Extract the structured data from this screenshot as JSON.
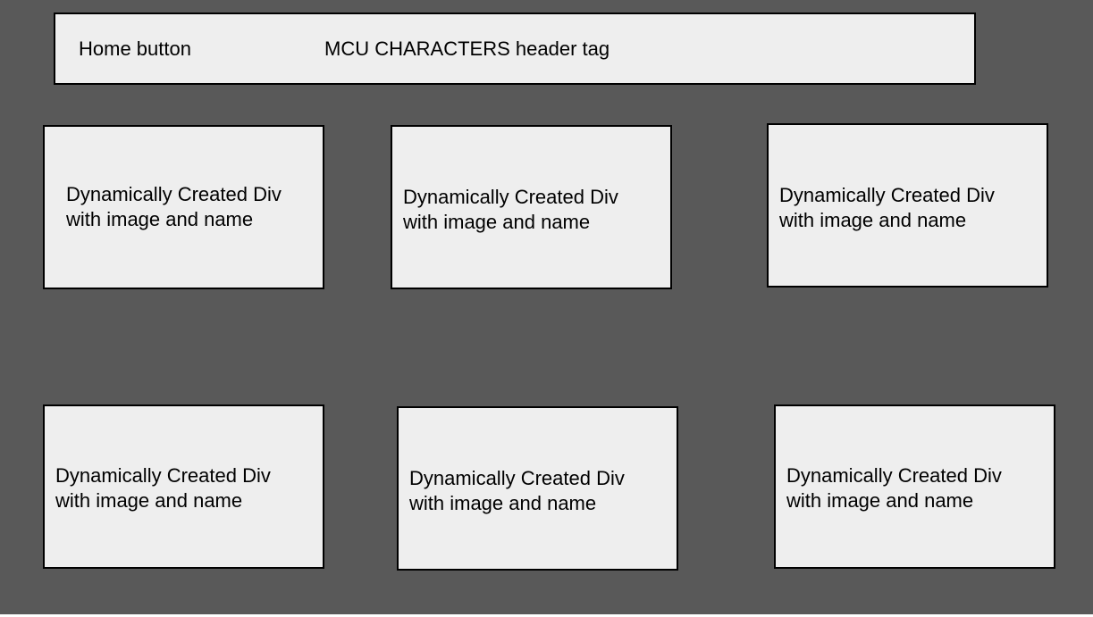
{
  "header": {
    "home_label": "Home button",
    "title_label": "MCU CHARACTERS header tag"
  },
  "cards": [
    {
      "label": "Dynamically Created Div\nwith image and name"
    },
    {
      "label": "Dynamically Created Div\nwith image and name"
    },
    {
      "label": "Dynamically Created Div\nwith image and name"
    },
    {
      "label": "Dynamically Created Div\nwith image and name"
    },
    {
      "label": "Dynamically Created Div\nwith image and name"
    },
    {
      "label": "Dynamically Created Div\nwith image and name"
    }
  ],
  "colors": {
    "background": "#595959",
    "box_fill": "#eeeeee",
    "border": "#000000"
  }
}
